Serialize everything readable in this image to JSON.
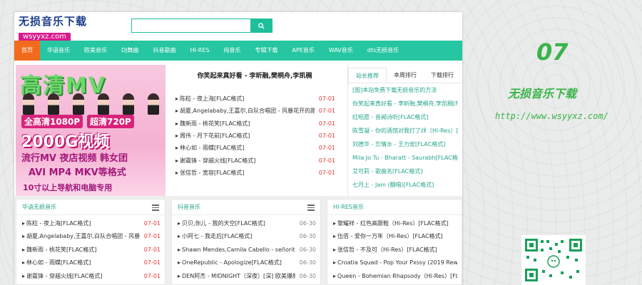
{
  "header": {
    "logo_title": "无损音乐下载",
    "logo_sub": "wsyyxz.com",
    "search_placeholder": ""
  },
  "nav": [
    {
      "label": "首页",
      "active": true
    },
    {
      "label": "华语音乐"
    },
    {
      "label": "欧美音乐"
    },
    {
      "label": "DJ舞曲"
    },
    {
      "label": "抖音歌曲"
    },
    {
      "label": "HI-RES"
    },
    {
      "label": "纯音乐"
    },
    {
      "label": "专辑下载"
    },
    {
      "label": "APE音乐"
    },
    {
      "label": "WAV音乐"
    },
    {
      "label": "dts无损音乐"
    }
  ],
  "banner": {
    "line1": "高清MV",
    "badge1": "全高清1080P",
    "badge2": "超清720P",
    "line2": "2000G视频",
    "line3": "流行MV 夜店视频 韩女团",
    "line4": "AVI MP4 MKV等格式",
    "line5": "10寸以上导航和电脑专用"
  },
  "featured": {
    "title": "你笑起来真好看 - 李昕融,樊桐舟,李凯稠",
    "items": [
      {
        "title": "陈粒 - 夜上海[FLAC格式]",
        "date": "07-01"
      },
      {
        "title": "胡夏,Angelababy,王嘉尔,白队合唱团 - 风暴花开的路口[FLA",
        "date": "07-01"
      },
      {
        "title": "魏新雨 - 桃花笑[FLAC格式]",
        "date": "07-01"
      },
      {
        "title": "周伟 - 月下花前[FLAC格式]",
        "date": "07-01"
      },
      {
        "title": "林心如 - 雨蝶[FLAC格式]",
        "date": "07-01"
      },
      {
        "title": "谢霆锋 - 穿越火线[FLAC格式]",
        "date": "07-01"
      },
      {
        "title": "张信哲 - 宽容[FLAC格式]",
        "date": "07-01"
      }
    ]
  },
  "tabs": [
    "站长推荐",
    "本周排行",
    "下载排行"
  ],
  "recommend": [
    "[图]本站免费下载无损音乐的方法",
    "你笑起来真好看 - 李昕融,樊桐舟,李凯稠[FLAC",
    "红昭愿 - 音阙诗听[FLAC格式]",
    "陈雪凝 - 你的酒馆对我打了烊（Hi-Res）[FLAC",
    "刘德华 - 忘情水 - 王力宏[FLAC格式]",
    "Mila Jo Tu - Bharatt - Saurabh[FLAC格式]",
    "艾可莉 - 歌曲名[FLAC格式]",
    "七月上 - Jam (翻唱)[FLAC格式]"
  ],
  "boxes": [
    {
      "title": "华语无损音乐",
      "items": [
        {
          "title": "陈粒 - 夜上海[FLAC格式]",
          "date": "07-01"
        },
        {
          "title": "胡夏,Angelababy,王嘉尔,白队合唱团 - 风暴花开",
          "date": "07-01"
        },
        {
          "title": "魏新雨 - 桃花笑[FLAC格式]",
          "date": "07-01"
        },
        {
          "title": "林心如 - 雨蝶[FLAC格式]",
          "date": "07-01"
        },
        {
          "title": "谢霆锋 - 穿越火线[FLAC格式]",
          "date": "07-01"
        }
      ]
    },
    {
      "title": "抖音音乐",
      "items": [
        {
          "title": "贝贝,你儿 - 我的天空[FLAC格式]",
          "date": "06-30"
        },
        {
          "title": "小阿七 - 我走后[FLAC格式]",
          "date": "06-30"
        },
        {
          "title": "Shawn Mendes,Camila Cabello - señorita[FLAC",
          "date": "06-30"
        },
        {
          "title": "OneRepublic - Apologize[FLAC格式]",
          "date": "06-30"
        },
        {
          "title": "DEN阿杰 - MIDNIGHT（深夜）[深] 欧美爆款",
          "date": "06-30"
        }
      ]
    },
    {
      "title": "HI-RES音乐",
      "items": [
        {
          "title": "黎耀祥 - 红色高跟鞋（Hi-Res）[FLAC格式]",
          "date": ""
        },
        {
          "title": "伍佰 - 爱你一万年（Hi-Res）[FLAC格式]",
          "date": ""
        },
        {
          "title": "张信哲 - 不及可（Hi-Res）[FLAC格式]",
          "date": ""
        },
        {
          "title": "Croatia Squad - Pop Your Pxssy (2019 Rewor",
          "date": ""
        },
        {
          "title": "Queen - Bohemian Rhapsody（Hi-Res）[FLAC",
          "date": ""
        }
      ]
    }
  ],
  "side": {
    "number": "07",
    "title": "无损音乐下载",
    "url": "http://www.wsyyxz.com/"
  }
}
